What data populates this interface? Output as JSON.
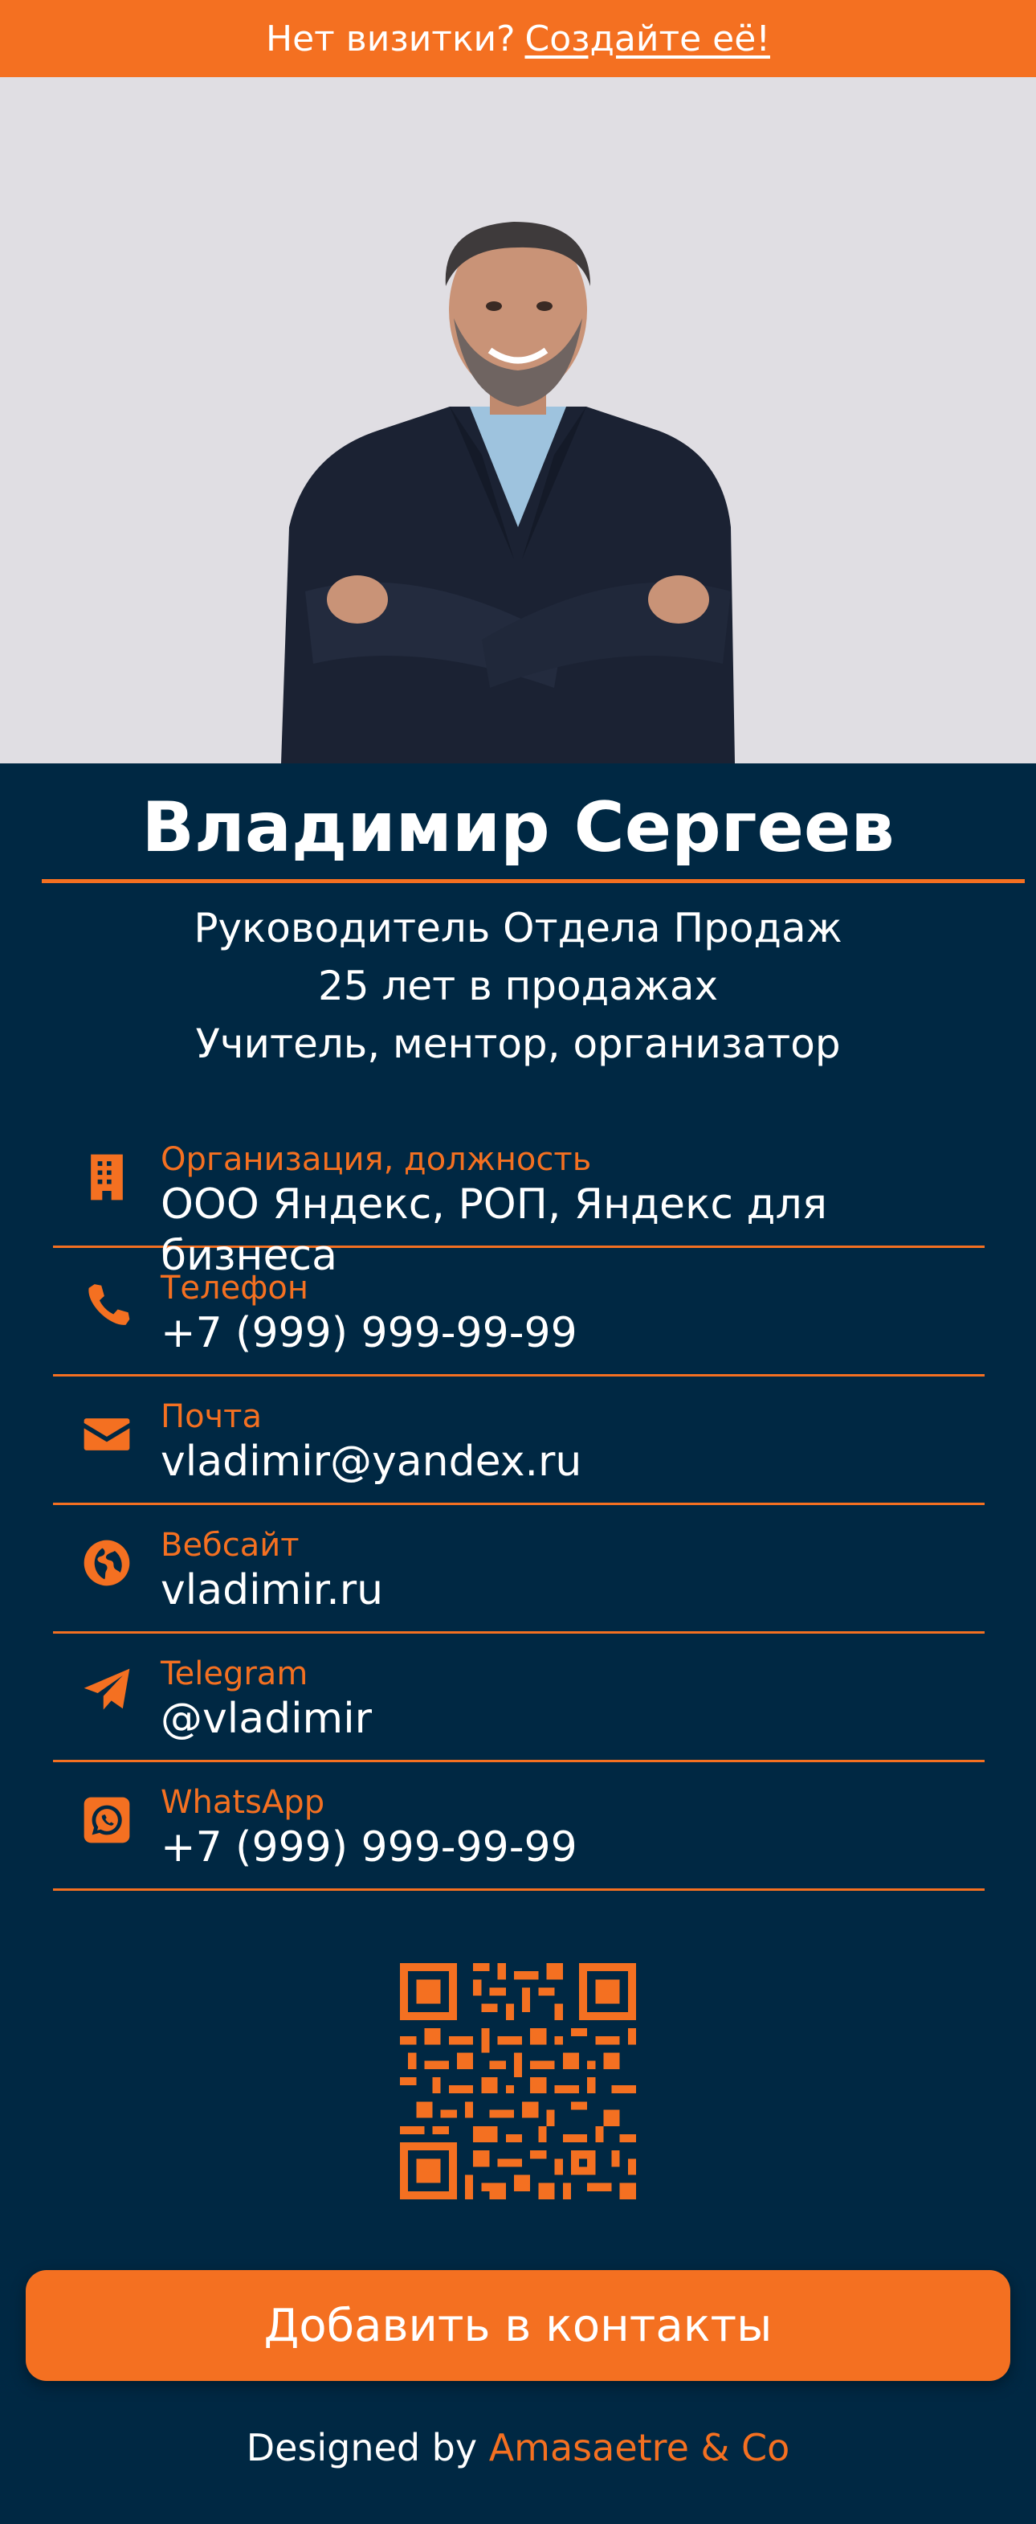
{
  "banner": {
    "text": "Нет визитки?",
    "link": "Создайте её!"
  },
  "profile": {
    "name": "Владимир Сергеев",
    "subtitle": [
      "Руководитель Отдела Продаж",
      "25 лет в продажах",
      "Учитель, ментор, организатор"
    ]
  },
  "contacts": [
    {
      "icon": "building-icon",
      "label": "Организация, должность",
      "value": "ООО Яндекс, РОП, Яндекс для бизнеса"
    },
    {
      "icon": "phone-icon",
      "label": "Телефон",
      "value": "+7 (999) 999-99-99"
    },
    {
      "icon": "envelope-icon",
      "label": "Почта",
      "value": "vladimir@yandex.ru"
    },
    {
      "icon": "globe-icon",
      "label": "Вебсайт",
      "value": "vladimir.ru"
    },
    {
      "icon": "telegram-icon",
      "label": "Telegram",
      "value": "@vladimir"
    },
    {
      "icon": "whatsapp-icon",
      "label": "WhatsApp",
      "value": "+7 (999) 999-99-99"
    }
  ],
  "add_contact_button": "Добавить в контакты",
  "footer": {
    "prefix": "Designed by",
    "brand": "Amasaetre & Co"
  },
  "colors": {
    "accent": "#f47021",
    "background": "#002843",
    "photo_background": "#e0dee3"
  }
}
